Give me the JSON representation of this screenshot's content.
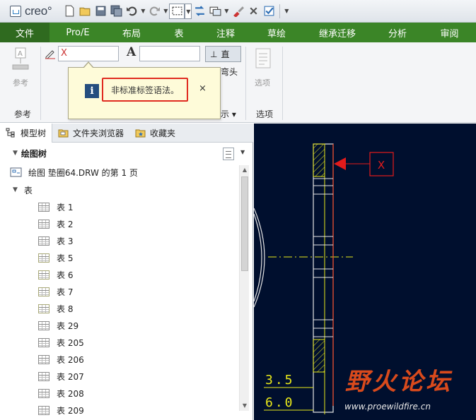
{
  "app": {
    "logo_text": "creo°"
  },
  "quick_access": {
    "icons": [
      "new-file-icon",
      "open-folder-icon",
      "save-icon",
      "save-copy-icon",
      "undo-icon",
      "redo-icon",
      "select-box-icon",
      "regenerate-icon",
      "window-icon",
      "paint-icon",
      "close-window-icon",
      "check-icon"
    ]
  },
  "tabs": [
    "文件",
    "Pro/E",
    "布局",
    "表",
    "注释",
    "草绘",
    "继承迁移",
    "分析",
    "审阅"
  ],
  "ribbon": {
    "ref_label": "参考",
    "ref_group": "参考",
    "symbol_value": "X",
    "font_glyph": "A",
    "text_field_value": "",
    "straight_label": "直",
    "elbow_label": "弯头",
    "format_suffix": "示 ▾",
    "options_label": "选项",
    "options_group": "选项"
  },
  "tooltip": {
    "message": "非标准标签语法。",
    "close": "×"
  },
  "panel_tabs": [
    {
      "label": "模型树",
      "icon": "model-tree-icon"
    },
    {
      "label": "文件夹浏览器",
      "icon": "folder-browser-icon"
    },
    {
      "label": "收藏夹",
      "icon": "favorites-icon"
    }
  ],
  "tree": {
    "title": "绘图树",
    "root": "绘图 垫圈64.DRW 的第 1 页",
    "group": "表",
    "items": [
      "表 1",
      "表 2",
      "表 3",
      "表 5",
      "表 6",
      "表 7",
      "表 8",
      "表 29",
      "表 205",
      "表 206",
      "表 207",
      "表 208",
      "表 209"
    ]
  },
  "canvas": {
    "callout": "X",
    "dim1": "3.5",
    "dim2": "6.0",
    "watermark": "野火论坛",
    "watermark_url": "www.proewildfire.cn",
    "colors": {
      "bg": "#000f2e",
      "yellow": "#e8e81a",
      "red": "#e21b1b"
    }
  }
}
